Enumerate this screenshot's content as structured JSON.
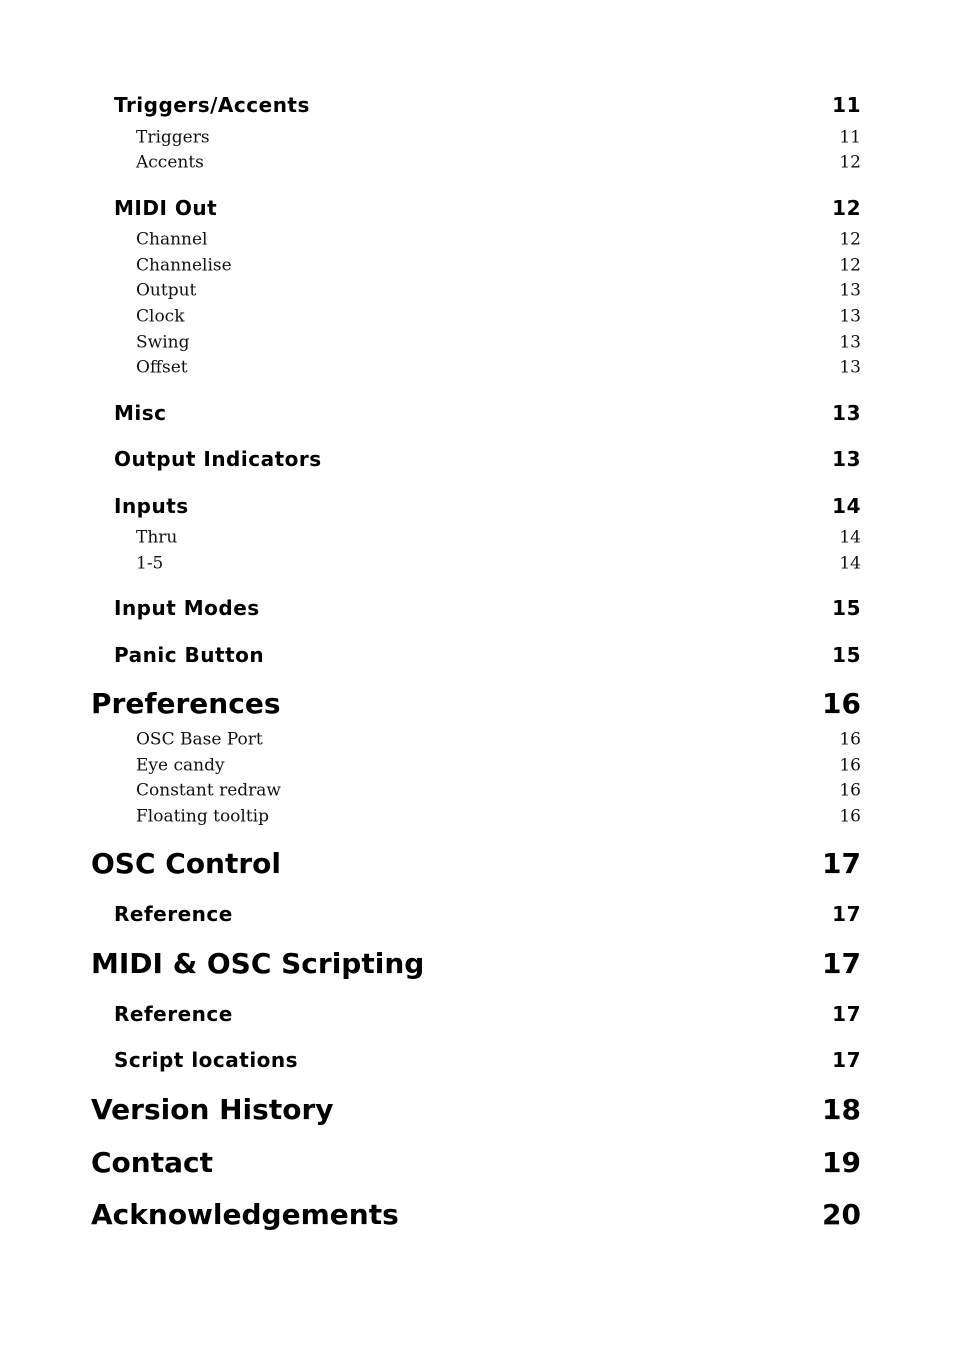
{
  "toc": [
    {
      "level": 2,
      "title": "Triggers/Accents",
      "page": "11"
    },
    {
      "level": 3,
      "title": "Triggers",
      "page": "11"
    },
    {
      "level": 3,
      "title": "Accents",
      "page": "12"
    },
    {
      "level": 2,
      "title": "MIDI Out",
      "page": "12"
    },
    {
      "level": 3,
      "title": "Channel",
      "page": "12"
    },
    {
      "level": 3,
      "title": "Channelise",
      "page": "12"
    },
    {
      "level": 3,
      "title": "Output",
      "page": "13"
    },
    {
      "level": 3,
      "title": "Clock",
      "page": "13"
    },
    {
      "level": 3,
      "title": "Swing",
      "page": "13"
    },
    {
      "level": 3,
      "title": "Offset",
      "page": "13"
    },
    {
      "level": 2,
      "title": "Misc",
      "page": "13"
    },
    {
      "level": 2,
      "title": "Output Indicators",
      "page": "13"
    },
    {
      "level": 2,
      "title": "Inputs",
      "page": "14"
    },
    {
      "level": 3,
      "title": "Thru",
      "page": "14"
    },
    {
      "level": 3,
      "title": "1-5",
      "page": "14"
    },
    {
      "level": 2,
      "title": "Input Modes",
      "page": "15"
    },
    {
      "level": 2,
      "title": "Panic Button",
      "page": "15"
    },
    {
      "level": 1,
      "title": "Preferences",
      "page": "16"
    },
    {
      "level": 3,
      "title": "OSC Base Port",
      "page": "16"
    },
    {
      "level": 3,
      "title": "Eye candy",
      "page": "16"
    },
    {
      "level": 3,
      "title": "Constant redraw",
      "page": "16"
    },
    {
      "level": 3,
      "title": "Floating tooltip",
      "page": "16"
    },
    {
      "level": 1,
      "title": "OSC Control",
      "page": "17"
    },
    {
      "level": 2,
      "title": "Reference",
      "page": "17"
    },
    {
      "level": 1,
      "title": "MIDI & OSC Scripting",
      "page": "17"
    },
    {
      "level": 2,
      "title": "Reference",
      "page": "17"
    },
    {
      "level": 2,
      "title": "Script locations",
      "page": "17"
    },
    {
      "level": 1,
      "title": "Version History",
      "page": "18"
    },
    {
      "level": 1,
      "title": "Contact",
      "page": "19"
    },
    {
      "level": 1,
      "title": "Acknowledgements",
      "page": "20"
    }
  ]
}
